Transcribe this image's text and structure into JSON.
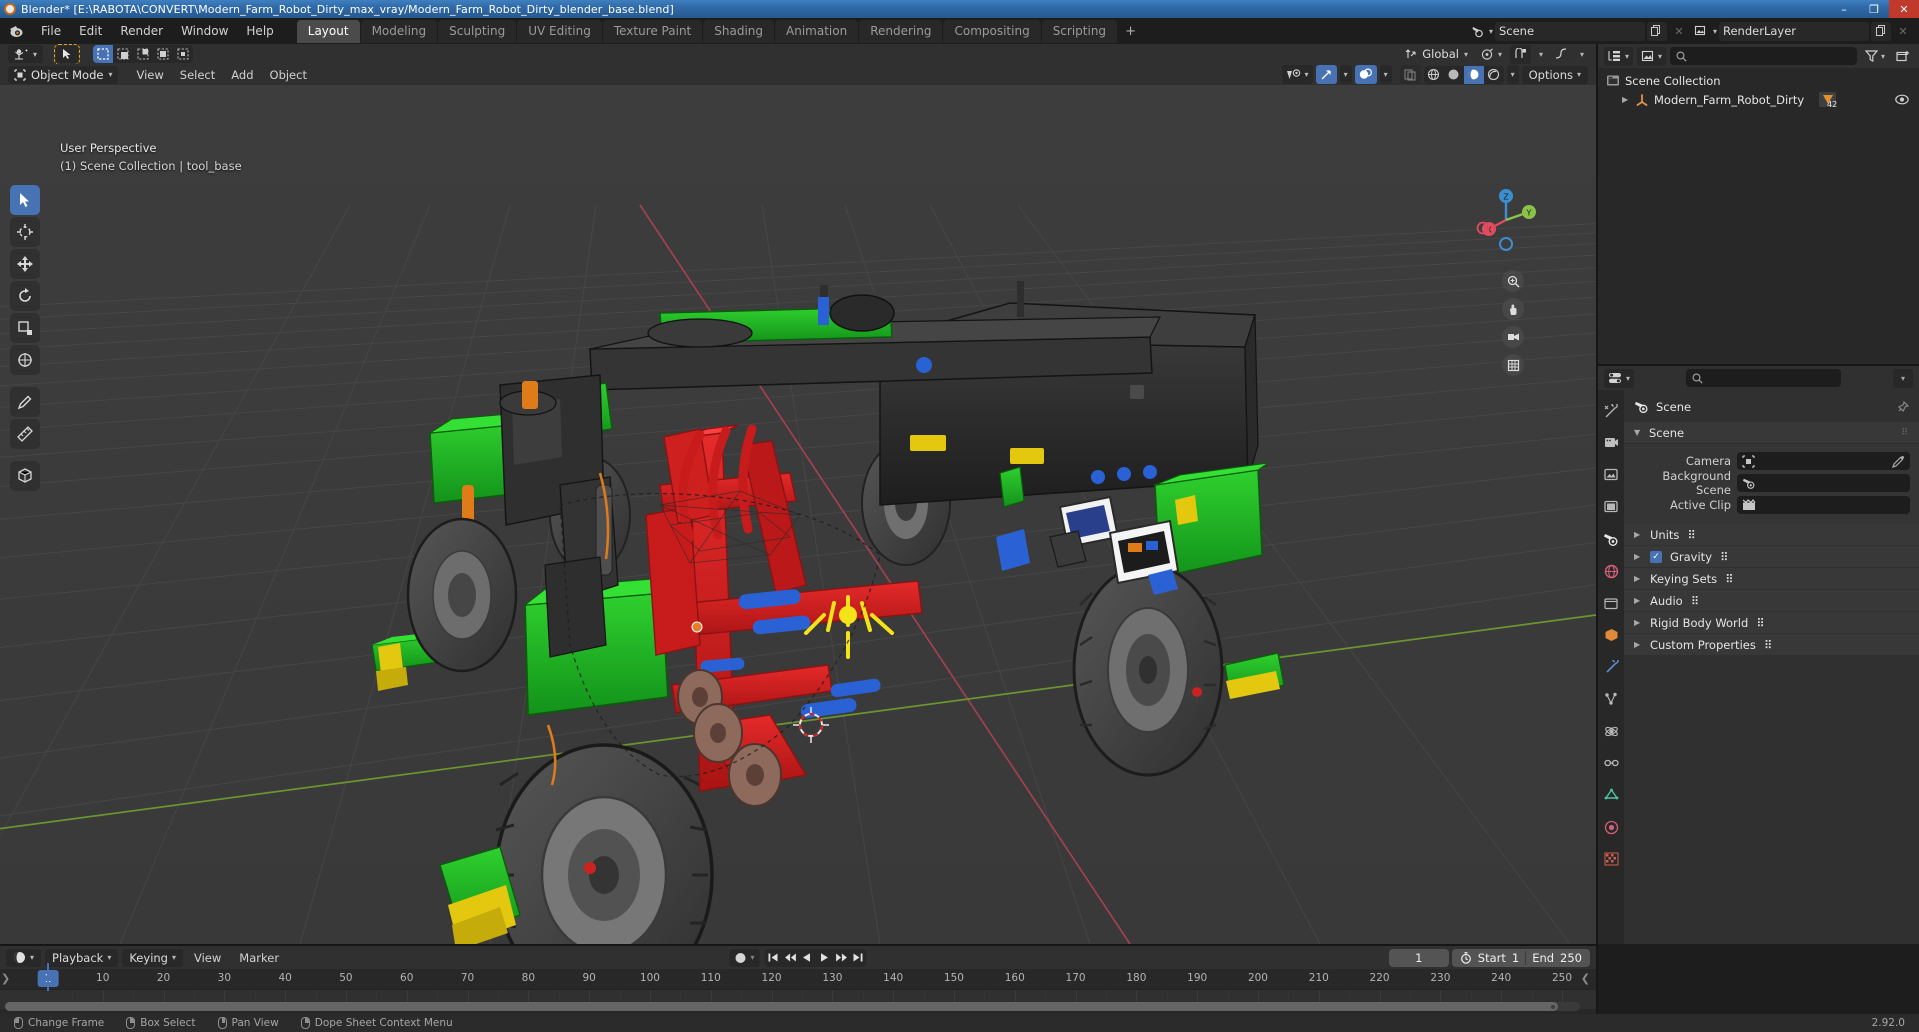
{
  "window": {
    "title": "Blender* [E:\\RABOTA\\CONVERT\\Modern_Farm_Robot_Dirty_max_vray/Modern_Farm_Robot_Dirty_blender_base.blend]",
    "minimize": "–",
    "maximize": "❐",
    "close": "✕"
  },
  "topbar": {
    "menus": [
      "File",
      "Edit",
      "Render",
      "Window",
      "Help"
    ],
    "workspaces": [
      {
        "label": "Layout",
        "active": true
      },
      {
        "label": "Modeling",
        "active": false
      },
      {
        "label": "Sculpting",
        "active": false
      },
      {
        "label": "UV Editing",
        "active": false
      },
      {
        "label": "Texture Paint",
        "active": false
      },
      {
        "label": "Shading",
        "active": false
      },
      {
        "label": "Animation",
        "active": false
      },
      {
        "label": "Rendering",
        "active": false
      },
      {
        "label": "Compositing",
        "active": false
      },
      {
        "label": "Scripting",
        "active": false
      }
    ],
    "add_workspace": "+",
    "scene_name": "Scene",
    "view_layer_name": "RenderLayer"
  },
  "viewport": {
    "mode": "Object Mode",
    "menus": [
      "View",
      "Select",
      "Add",
      "Object"
    ],
    "transform_orientation": "Global",
    "options_label": "Options",
    "overlay_line1": "User Perspective",
    "overlay_line2": "(1) Scene Collection | tool_base",
    "background_color": "#3b3b3b",
    "grid_color": "#4e4e4e",
    "axis_x_color": "#c4485a",
    "axis_y_color": "#7aa832",
    "gizmo_x_color": "#e04c5f",
    "gizmo_y_color": "#8bc34a",
    "gizmo_z_color": "#3b8ed0",
    "gizmo_labels": [
      "X",
      "Y",
      "Z"
    ],
    "model_colors": {
      "body_dark": "#2b2b2b",
      "green": "#1fb11f",
      "red": "#d22020",
      "yellow": "#e8d118",
      "orange": "#e07b1a",
      "tire": "#4a4a4a",
      "blue": "#2b5fd0"
    }
  },
  "outliner": {
    "search_placeholder": "",
    "filter_icon": "funnel-icon",
    "new_collection_icon": "new-collection-icon",
    "rows": [
      {
        "label": "Scene Collection",
        "icon": "collection-icon",
        "indent": 0,
        "badge": "",
        "eye": false
      },
      {
        "label": "Modern_Farm_Robot_Dirty",
        "icon": "empty-axis-icon",
        "indent": 1,
        "badge": "42",
        "eye": true
      }
    ]
  },
  "properties": {
    "search_placeholder": "",
    "breadcrumb": "Scene",
    "tabs": [
      "tool-icon",
      "render-icon",
      "output-icon",
      "view-layer-icon",
      "scene-icon",
      "world-icon",
      "collection-icon",
      "object-icon",
      "modifier-icon",
      "particles-icon",
      "physics-icon",
      "constraints-icon",
      "data-icon",
      "material-icon",
      "texture-icon"
    ],
    "active_tab_index": 4,
    "panels": [
      {
        "name": "Scene",
        "open": true,
        "rows": [
          {
            "label": "Camera",
            "value": "",
            "icon": "camera-icon",
            "right_icon": "eyedropper-icon"
          },
          {
            "label": "Background Scene",
            "value": "",
            "icon": "scene-icon",
            "right_icon": ""
          },
          {
            "label": "Active Clip",
            "value": "",
            "icon": "clip-icon",
            "right_icon": ""
          }
        ]
      },
      {
        "name": "Units",
        "open": false,
        "checkbox": null
      },
      {
        "name": "Gravity",
        "open": false,
        "checkbox": true
      },
      {
        "name": "Keying Sets",
        "open": false,
        "checkbox": null
      },
      {
        "name": "Audio",
        "open": false,
        "checkbox": null
      },
      {
        "name": "Rigid Body World",
        "open": false,
        "checkbox": null
      },
      {
        "name": "Custom Properties",
        "open": false,
        "checkbox": null
      }
    ]
  },
  "timeline": {
    "menus": [
      "Playback",
      "Keying",
      "View",
      "Marker"
    ],
    "current_frame": "1",
    "start_label": "Start",
    "start_value": "1",
    "end_label": "End",
    "end_value": "250",
    "ticks": [
      {
        "label": "10",
        "frame": 10
      },
      {
        "label": "20",
        "frame": 20
      },
      {
        "label": "30",
        "frame": 30
      },
      {
        "label": "40",
        "frame": 40
      },
      {
        "label": "50",
        "frame": 50
      },
      {
        "label": "60",
        "frame": 60
      },
      {
        "label": "70",
        "frame": 70
      },
      {
        "label": "80",
        "frame": 80
      },
      {
        "label": "90",
        "frame": 90
      },
      {
        "label": "100",
        "frame": 100
      },
      {
        "label": "110",
        "frame": 110
      },
      {
        "label": "120",
        "frame": 120
      },
      {
        "label": "130",
        "frame": 130
      },
      {
        "label": "140",
        "frame": 140
      },
      {
        "label": "150",
        "frame": 150
      },
      {
        "label": "160",
        "frame": 160
      },
      {
        "label": "170",
        "frame": 170
      },
      {
        "label": "180",
        "frame": 180
      },
      {
        "label": "190",
        "frame": 190
      },
      {
        "label": "200",
        "frame": 200
      },
      {
        "label": "210",
        "frame": 210
      },
      {
        "label": "220",
        "frame": 220
      },
      {
        "label": "230",
        "frame": 230
      },
      {
        "label": "240",
        "frame": 240
      },
      {
        "label": "250",
        "frame": 250
      }
    ],
    "playhead_frame": 1
  },
  "statusbar": {
    "items": [
      {
        "mouse": "left",
        "label": "Change Frame"
      },
      {
        "mouse": "right",
        "label": "Box Select"
      },
      {
        "mouse": "middle",
        "label": "Pan View"
      },
      {
        "mouse": "right2",
        "label": "Dope Sheet Context Menu"
      }
    ],
    "version": "2.92.0"
  }
}
